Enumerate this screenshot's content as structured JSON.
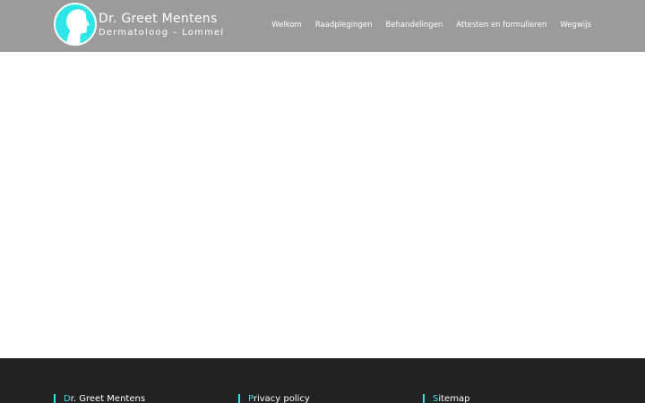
{
  "header": {
    "brand_name": "Dr. Greet Mentens",
    "brand_sub": "Dermatoloog – Lommel",
    "logo_icon": "face-profile-icon",
    "accent_color": "#2ee6e6",
    "background_color": "#9b9b9b"
  },
  "nav": {
    "items": [
      {
        "label": "Welkom"
      },
      {
        "label": "Raadplegingen"
      },
      {
        "label": "Behandelingen"
      },
      {
        "label": "Attesten en formulieren"
      },
      {
        "label": "Wegwijs"
      }
    ]
  },
  "footer": {
    "background_color": "#222222",
    "columns": [
      {
        "first_letter": "D",
        "rest": "r. Greet Mentens"
      },
      {
        "first_letter": "P",
        "rest": "rivacy policy"
      },
      {
        "first_letter": "S",
        "rest": "itemap"
      }
    ]
  }
}
